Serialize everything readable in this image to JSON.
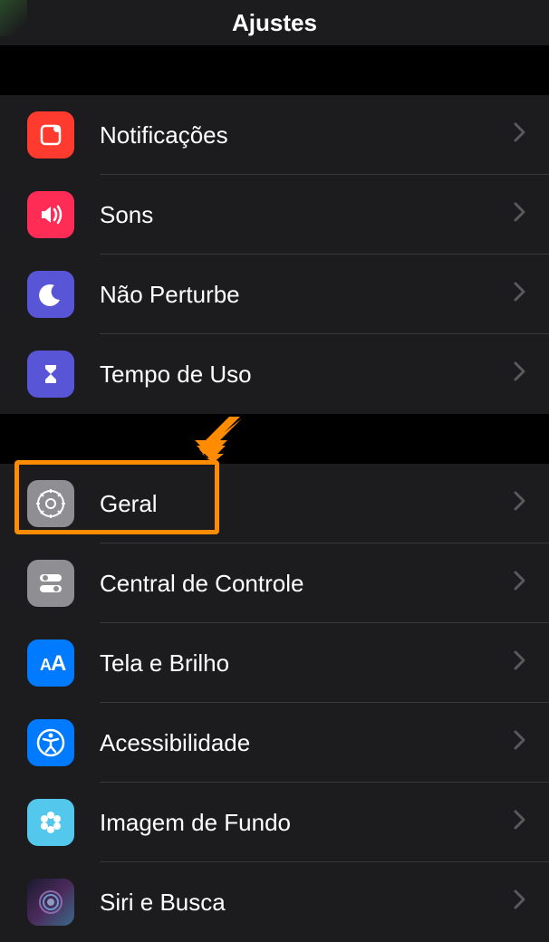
{
  "header": {
    "title": "Ajustes"
  },
  "group1": [
    {
      "label": "Notificações",
      "icon": "notifications"
    },
    {
      "label": "Sons",
      "icon": "sounds"
    },
    {
      "label": "Não Perturbe",
      "icon": "dnd"
    },
    {
      "label": "Tempo de Uso",
      "icon": "screentime"
    }
  ],
  "group2": [
    {
      "label": "Geral",
      "icon": "general",
      "highlighted": true
    },
    {
      "label": "Central de Controle",
      "icon": "control"
    },
    {
      "label": "Tela e Brilho",
      "icon": "display"
    },
    {
      "label": "Acessibilidade",
      "icon": "accessibility"
    },
    {
      "label": "Imagem de Fundo",
      "icon": "wallpaper"
    },
    {
      "label": "Siri e Busca",
      "icon": "siri"
    }
  ],
  "annotation": {
    "highlight_color": "#ff8c00"
  }
}
